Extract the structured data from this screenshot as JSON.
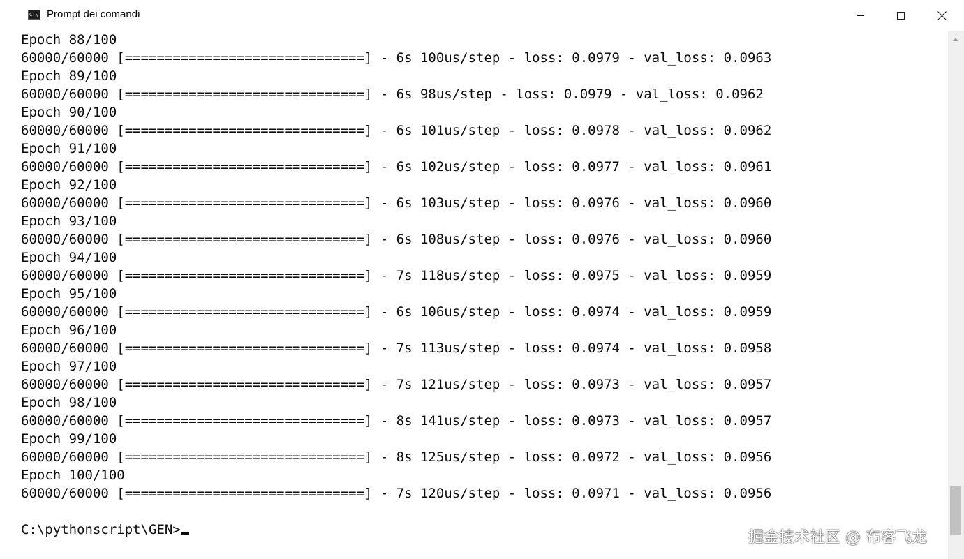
{
  "window": {
    "title": "Prompt dei comandi",
    "icon": "cmd-icon",
    "icon_glyph": "C:\\",
    "controls": [
      "minimize-icon",
      "maximize-icon",
      "close-icon"
    ]
  },
  "console": {
    "lines": [
      "Epoch 88/100",
      "60000/60000 [==============================] - 6s 100us/step - loss: 0.0979 - val_loss: 0.0963",
      "Epoch 89/100",
      "60000/60000 [==============================] - 6s 98us/step - loss: 0.0979 - val_loss: 0.0962",
      "Epoch 90/100",
      "60000/60000 [==============================] - 6s 101us/step - loss: 0.0978 - val_loss: 0.0962",
      "Epoch 91/100",
      "60000/60000 [==============================] - 6s 102us/step - loss: 0.0977 - val_loss: 0.0961",
      "Epoch 92/100",
      "60000/60000 [==============================] - 6s 103us/step - loss: 0.0976 - val_loss: 0.0960",
      "Epoch 93/100",
      "60000/60000 [==============================] - 6s 108us/step - loss: 0.0976 - val_loss: 0.0960",
      "Epoch 94/100",
      "60000/60000 [==============================] - 7s 118us/step - loss: 0.0975 - val_loss: 0.0959",
      "Epoch 95/100",
      "60000/60000 [==============================] - 6s 106us/step - loss: 0.0974 - val_loss: 0.0959",
      "Epoch 96/100",
      "60000/60000 [==============================] - 7s 113us/step - loss: 0.0974 - val_loss: 0.0958",
      "Epoch 97/100",
      "60000/60000 [==============================] - 7s 121us/step - loss: 0.0973 - val_loss: 0.0957",
      "Epoch 98/100",
      "60000/60000 [==============================] - 8s 141us/step - loss: 0.0973 - val_loss: 0.0957",
      "Epoch 99/100",
      "60000/60000 [==============================] - 8s 125us/step - loss: 0.0972 - val_loss: 0.0956",
      "Epoch 100/100",
      "60000/60000 [==============================] - 7s 120us/step - loss: 0.0971 - val_loss: 0.0956"
    ],
    "prompt": "C:\\pythonscript\\GEN>"
  },
  "watermark": "掘金技术社区 @ 布客飞龙"
}
